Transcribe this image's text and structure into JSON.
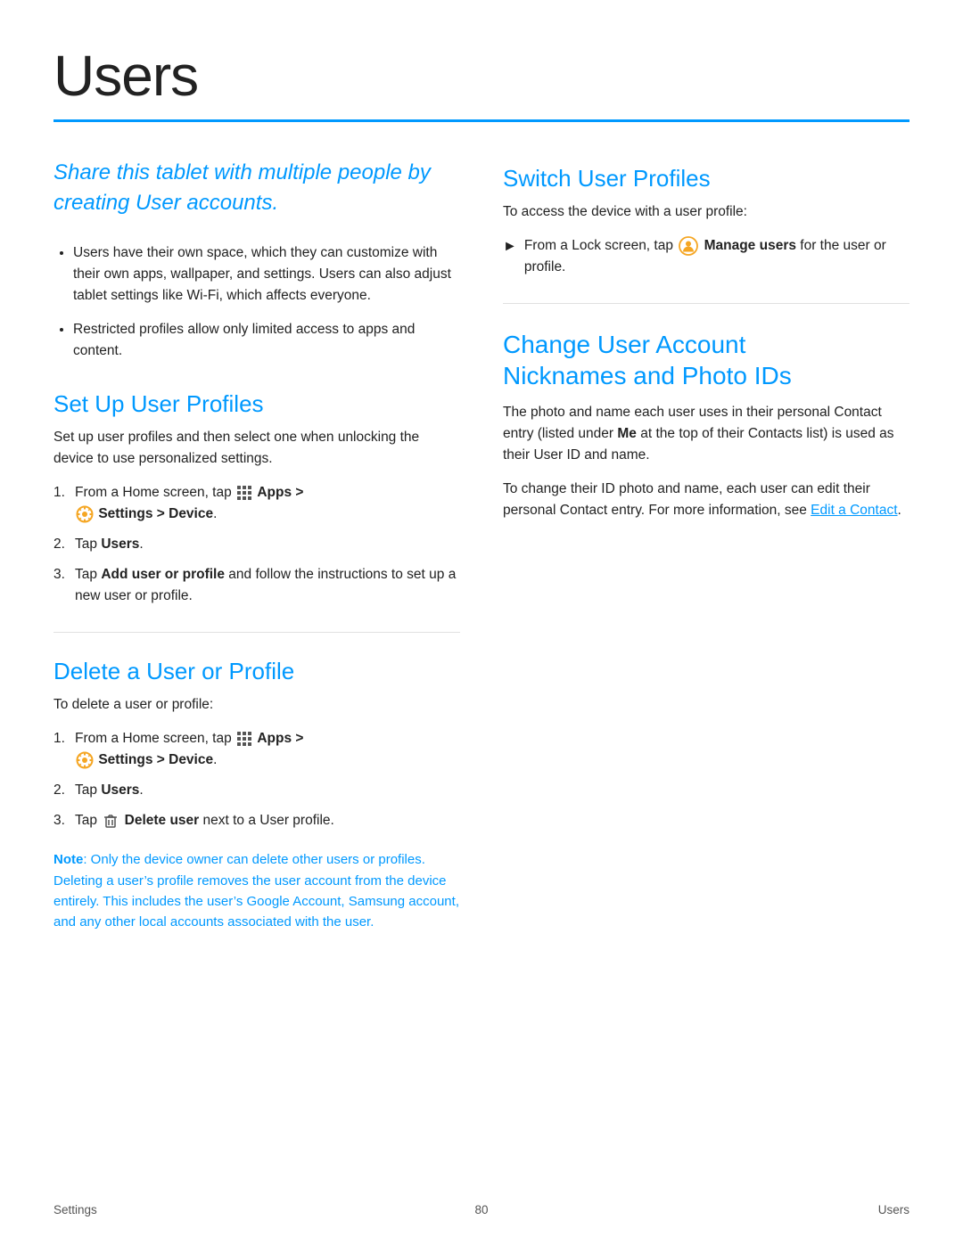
{
  "page": {
    "title": "Users",
    "footer_left": "Settings",
    "footer_page": "80",
    "footer_right": "Users"
  },
  "intro": {
    "text": "Share this tablet with multiple people by creating User accounts."
  },
  "bullets": [
    "Users have their own space, which they can customize with their own apps, wallpaper, and settings. Users can also adjust tablet settings like Wi-Fi, which affects everyone.",
    "Restricted profiles allow only limited access to apps and content."
  ],
  "set_up": {
    "heading": "Set Up User Profiles",
    "body": "Set up user profiles and then select one when unlocking the device to use personalized settings.",
    "steps": [
      {
        "text": "From a Home screen, tap",
        "bold_part": "Apps >",
        "icon": "apps",
        "step2": "Settings > Device.",
        "icon2": "settings"
      },
      {
        "text": "Tap",
        "bold_part": "Users",
        "suffix": "."
      },
      {
        "text": "Tap",
        "bold_part": "Add user or profile",
        "suffix": " and follow the instructions to set up a new user or profile."
      }
    ]
  },
  "delete": {
    "heading": "Delete a User or Profile",
    "body": "To delete a user or profile:",
    "steps": [
      {
        "text": "From a Home screen, tap",
        "bold_part": "Apps >",
        "icon": "apps",
        "step2": "Settings > Device.",
        "icon2": "settings"
      },
      {
        "text": "Tap",
        "bold_part": "Users",
        "suffix": "."
      },
      {
        "text": "Tap",
        "icon": "trash",
        "bold_part": "Delete user",
        "suffix": " next to a User profile."
      }
    ],
    "note_label": "Note",
    "note_text": ": Only the device owner can delete other users or profiles. Deleting a user’s profile removes the user account from the device entirely. This includes the user’s Google Account, Samsung account, and any other local accounts associated with the user."
  },
  "switch": {
    "heading": "Switch User Profiles",
    "body": "To access the device with a user profile:",
    "arrow_text": "From a Lock screen, tap",
    "arrow_bold": "Manage users",
    "arrow_suffix": " for the user or profile."
  },
  "change": {
    "heading_line1": "Change User Account",
    "heading_line2": "Nicknames and Photo IDs",
    "para1": "The photo and name each user uses in their personal Contact entry (listed under",
    "para1_bold": "Me",
    "para1_suffix": " at the top of their Contacts list) is used as their User ID and name.",
    "para2_pre": "To change their ID photo and name, each user can edit their personal Contact entry. For more information, see ",
    "para2_link": "Edit a Contact",
    "para2_post": "."
  }
}
